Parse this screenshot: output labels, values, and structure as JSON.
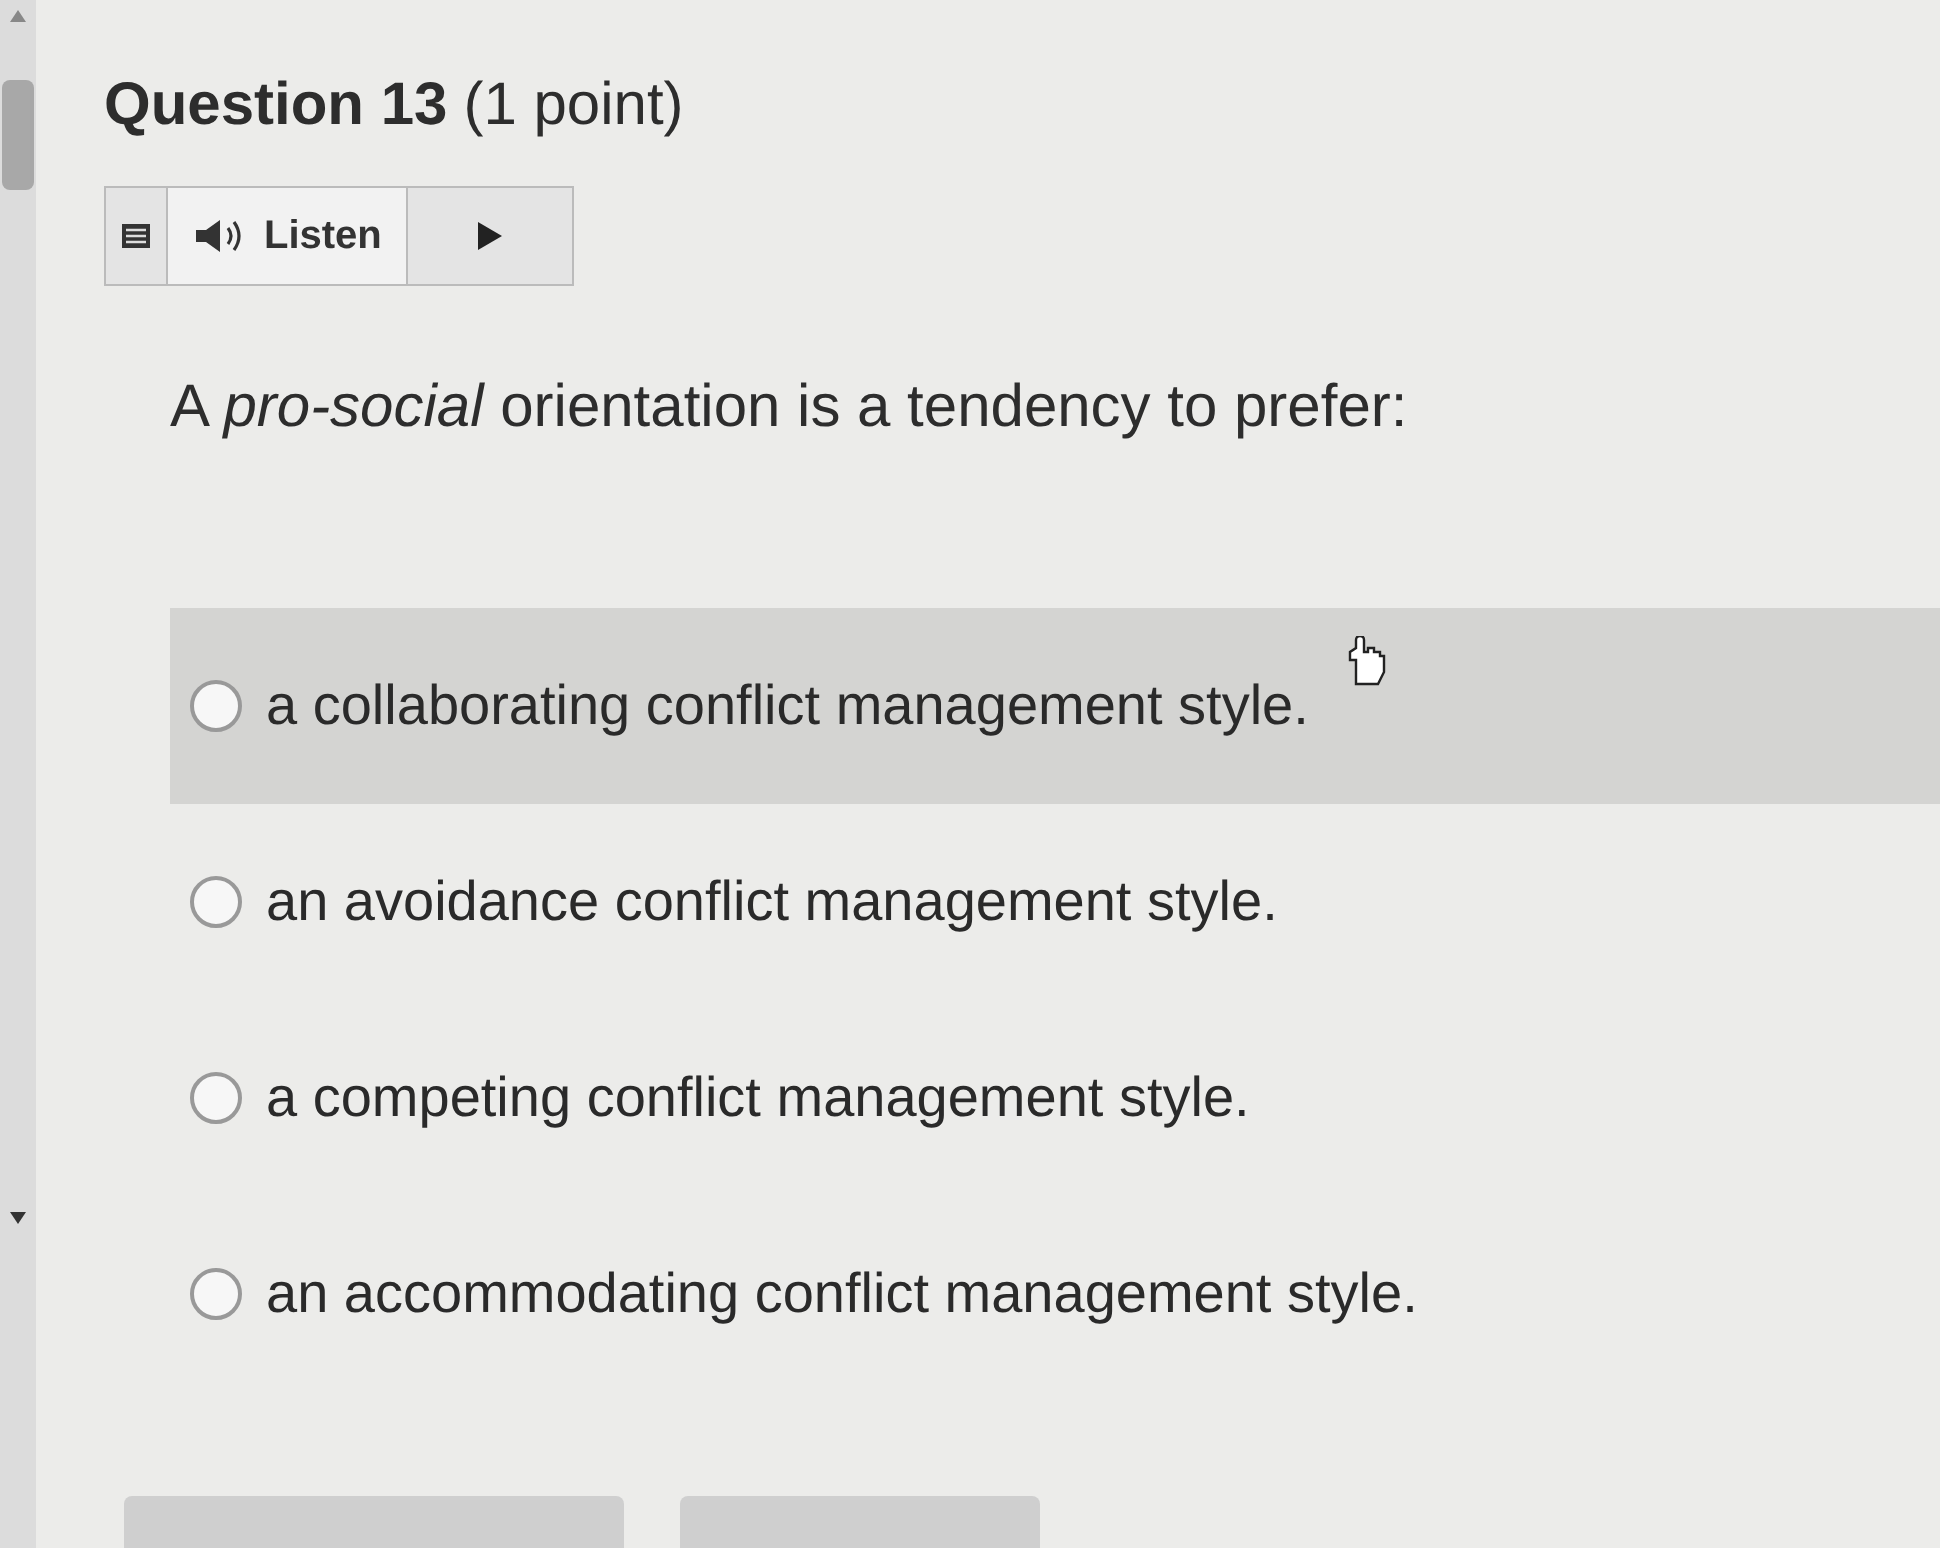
{
  "question": {
    "title": "Question 13",
    "points": "(1 point)"
  },
  "toolbar": {
    "listen_label": "Listen"
  },
  "prompt": "A *pro-social* orientation is a tendency to prefer:",
  "options": [
    {
      "label": "a collaborating conflict management style.",
      "selected": false,
      "highlighted": true
    },
    {
      "label": "an avoidance conflict management style.",
      "selected": false,
      "highlighted": false
    },
    {
      "label": "a competing conflict management style.",
      "selected": false,
      "highlighted": false
    },
    {
      "label": "an accommodating conflict management style.",
      "selected": false,
      "highlighted": false
    }
  ]
}
